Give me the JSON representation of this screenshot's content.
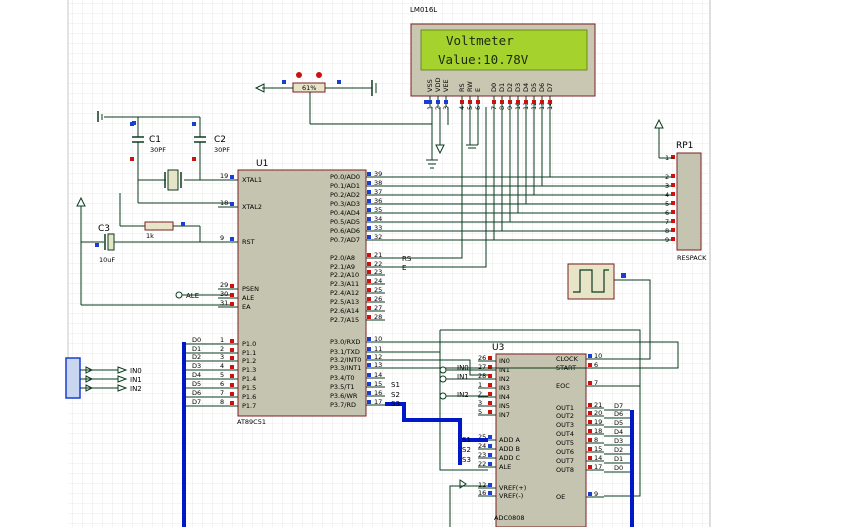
{
  "lcd": {
    "part": "LM016L",
    "line1": "Voltmeter",
    "line2": "Value:10.78V",
    "pins": [
      "VSS",
      "VDD",
      "VEE",
      "RS",
      "RW",
      "E",
      "D0",
      "D1",
      "D2",
      "D3",
      "D4",
      "D5",
      "D6",
      "D7"
    ],
    "pin_numbers": [
      "1",
      "2",
      "3",
      "4",
      "5",
      "6",
      "7",
      "8",
      "9",
      "10",
      "11",
      "12",
      "13",
      "14"
    ]
  },
  "pot": {
    "value": "61%"
  },
  "caps": {
    "c1": {
      "ref": "C1",
      "value": "30PF"
    },
    "c2": {
      "ref": "C2",
      "value": "30PF"
    },
    "c3": {
      "ref": "C3",
      "value": "10uF"
    }
  },
  "resistor": {
    "value": "1k"
  },
  "u1": {
    "ref": "U1",
    "part": "AT89C51",
    "left_pins": [
      {
        "num": "19",
        "name": "XTAL1"
      },
      {
        "num": "18",
        "name": "XTAL2"
      },
      {
        "num": "9",
        "name": "RST"
      },
      {
        "num": "29",
        "name": "PSEN"
      },
      {
        "num": "30",
        "name": "ALE"
      },
      {
        "num": "31",
        "name": "EA"
      },
      {
        "num": "1",
        "name": "P1.0"
      },
      {
        "num": "2",
        "name": "P1.1"
      },
      {
        "num": "3",
        "name": "P1.2"
      },
      {
        "num": "4",
        "name": "P1.3"
      },
      {
        "num": "5",
        "name": "P1.4"
      },
      {
        "num": "6",
        "name": "P1.5"
      },
      {
        "num": "7",
        "name": "P1.6"
      },
      {
        "num": "8",
        "name": "P1.7"
      }
    ],
    "right_pins": [
      {
        "num": "39",
        "name": "P0.0/AD0"
      },
      {
        "num": "38",
        "name": "P0.1/AD1"
      },
      {
        "num": "37",
        "name": "P0.2/AD2"
      },
      {
        "num": "36",
        "name": "P0.3/AD3"
      },
      {
        "num": "35",
        "name": "P0.4/AD4"
      },
      {
        "num": "34",
        "name": "P0.5/AD5"
      },
      {
        "num": "33",
        "name": "P0.6/AD6"
      },
      {
        "num": "32",
        "name": "P0.7/AD7"
      },
      {
        "num": "21",
        "name": "P2.0/A8"
      },
      {
        "num": "22",
        "name": "P2.1/A9"
      },
      {
        "num": "23",
        "name": "P2.2/A10"
      },
      {
        "num": "24",
        "name": "P2.3/A11"
      },
      {
        "num": "25",
        "name": "P2.4/A12"
      },
      {
        "num": "26",
        "name": "P2.5/A13"
      },
      {
        "num": "27",
        "name": "P2.6/A14"
      },
      {
        "num": "28",
        "name": "P2.7/A15"
      },
      {
        "num": "10",
        "name": "P3.0/RXD"
      },
      {
        "num": "11",
        "name": "P3.1/TXD"
      },
      {
        "num": "12",
        "name": "P3.2/INT0"
      },
      {
        "num": "13",
        "name": "P3.3/INT1"
      },
      {
        "num": "14",
        "name": "P3.4/T0"
      },
      {
        "num": "15",
        "name": "P3.5/T1"
      },
      {
        "num": "16",
        "name": "P3.6/WR"
      },
      {
        "num": "17",
        "name": "P3.7/RD"
      }
    ]
  },
  "u3": {
    "ref": "U3",
    "part": "ADC0808",
    "left_pins": [
      {
        "num": "26",
        "name": "IN0"
      },
      {
        "num": "27",
        "name": "IN1"
      },
      {
        "num": "28",
        "name": "IN2"
      },
      {
        "num": "1",
        "name": "IN3"
      },
      {
        "num": "2",
        "name": "IN4"
      },
      {
        "num": "3",
        "name": "IN5"
      },
      {
        "num": "5",
        "name": "IN7"
      },
      {
        "num": "25",
        "name": "ADD A"
      },
      {
        "num": "24",
        "name": "ADD B"
      },
      {
        "num": "23",
        "name": "ADD C"
      },
      {
        "num": "22",
        "name": "ALE"
      },
      {
        "num": "12",
        "name": "VREF(+)"
      },
      {
        "num": "16",
        "name": "VREF(-)"
      }
    ],
    "right_pins": [
      {
        "num": "10",
        "name": "CLOCK"
      },
      {
        "num": "6",
        "name": "START"
      },
      {
        "num": "7",
        "name": "EOC"
      },
      {
        "num": "21",
        "name": "OUT1"
      },
      {
        "num": "20",
        "name": "OUT2"
      },
      {
        "num": "19",
        "name": "OUT3"
      },
      {
        "num": "18",
        "name": "OUT4"
      },
      {
        "num": "8",
        "name": "OUT5"
      },
      {
        "num": "15",
        "name": "OUT6"
      },
      {
        "num": "14",
        "name": "OUT7"
      },
      {
        "num": "17",
        "name": "OUT8"
      },
      {
        "num": "9",
        "name": "OE"
      }
    ],
    "bus_labels": [
      "D7",
      "D6",
      "D5",
      "D4",
      "D3",
      "D2",
      "D1",
      "D0"
    ]
  },
  "rp1": {
    "ref": "RP1",
    "part": "RESPACK",
    "pins": [
      "1",
      "2",
      "3",
      "4",
      "5",
      "6",
      "7",
      "8",
      "9"
    ]
  },
  "net_labels": {
    "rs": "RS",
    "e": "E",
    "ale": "ALE",
    "s1": "S1",
    "s2": "S2",
    "s3": "S3",
    "p1_bus": [
      "D0",
      "D1",
      "D2",
      "D3",
      "D4",
      "D5",
      "D6",
      "D7"
    ],
    "in0": "IN0",
    "in1": "IN1",
    "in2": "IN2",
    "left_in": [
      "IN0",
      "IN1",
      "IN2"
    ]
  }
}
